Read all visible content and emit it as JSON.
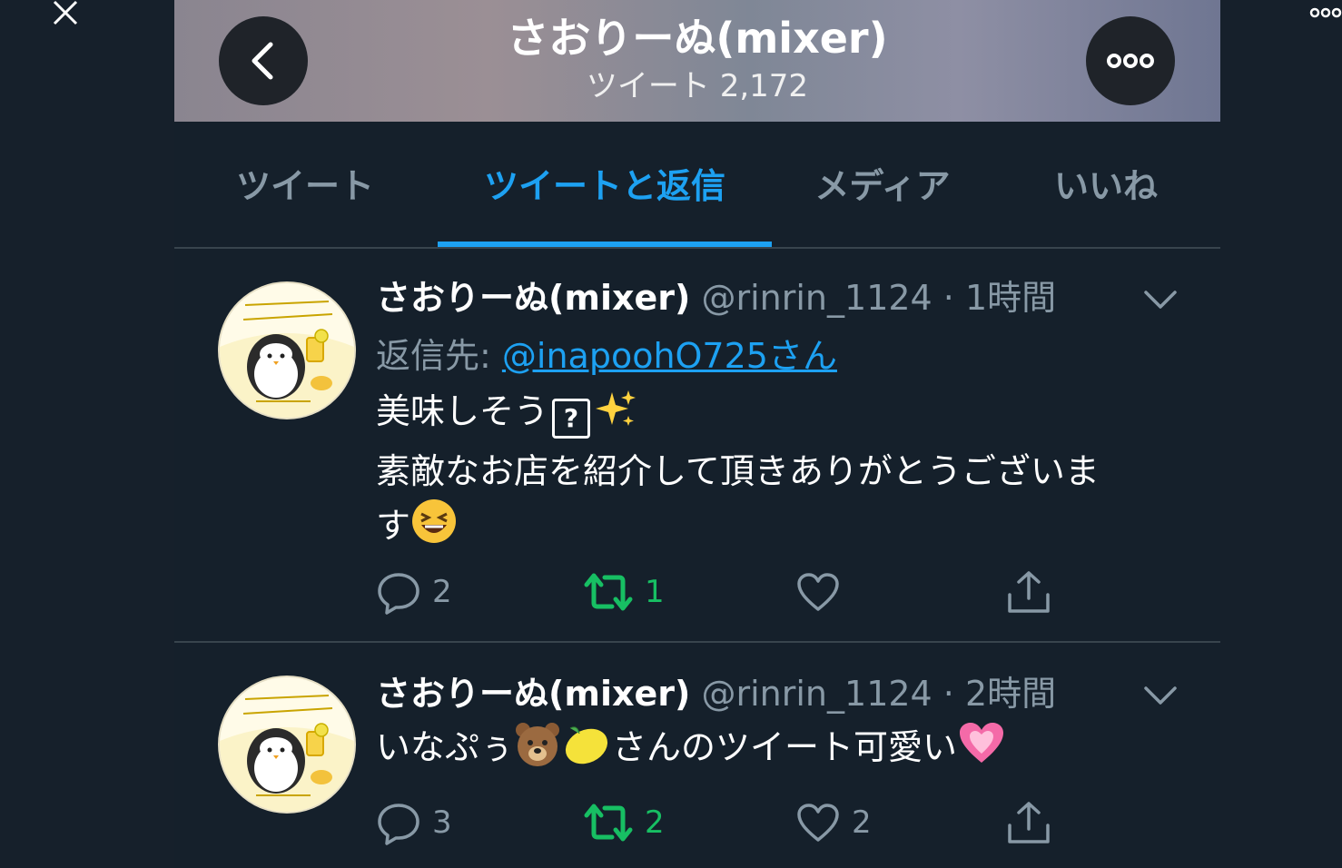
{
  "viewer": {
    "close_icon": "close-icon",
    "more_icon": "more-dots-icon"
  },
  "header": {
    "title": "さおりーぬ(mixer)",
    "subtitle": "ツイート 2,172",
    "back_icon": "back-arrow-icon",
    "more_icon": "more-dots-icon"
  },
  "tabs": [
    {
      "label": "ツイート",
      "active": false
    },
    {
      "label": "ツイートと返信",
      "active": true
    },
    {
      "label": "メディア",
      "active": false
    },
    {
      "label": "いいね",
      "active": false
    }
  ],
  "tweets": [
    {
      "name": "さおりーぬ(mixer)",
      "meta": "@rinrin_1124 · 1時間",
      "reply_label": "返信先: ",
      "reply_handle": "@inapoohO725さん",
      "lines": [
        "美味しそう",
        "素敵なお店を紹介して頂きありがとうございま",
        "す"
      ],
      "replies": "2",
      "retweets": "1",
      "likes": ""
    },
    {
      "name": "さおりーぬ(mixer)",
      "meta": "@rinrin_1124 · 2時間",
      "lines": [
        "いなぷぅ",
        "さんのツイート可愛い"
      ],
      "replies": "3",
      "retweets": "2",
      "likes": "2"
    }
  ],
  "colors": {
    "background": "#15202b",
    "accent": "#1da1f2",
    "retweet": "#17bf63",
    "secondary_text": "#8899a6",
    "divider": "#38444d"
  }
}
